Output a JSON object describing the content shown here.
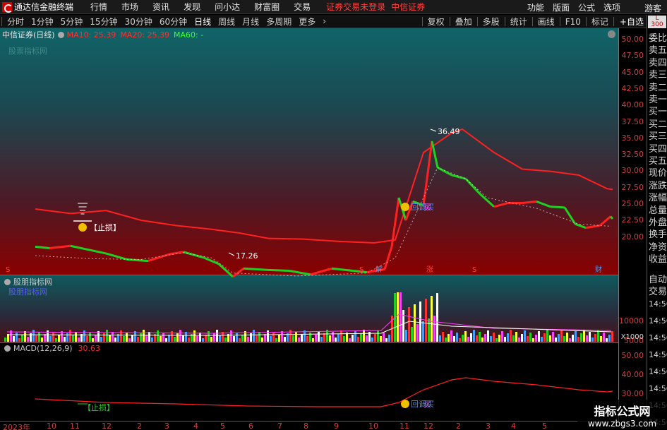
{
  "app": {
    "title": "通达信金融终端"
  },
  "menu": [
    "行情",
    "市场",
    "资讯",
    "发现",
    "问小达",
    "财富圈",
    "交易"
  ],
  "notice": "证券交易未登录",
  "broker": "中信证券",
  "right_menu": [
    "功能",
    "版面",
    "公式",
    "选项"
  ],
  "guest": "游客",
  "periods": [
    "分时",
    "1分钟",
    "5分钟",
    "15分钟",
    "30分钟",
    "60分钟",
    "日线",
    "周线",
    "月线",
    "多周期",
    "更多"
  ],
  "active_period": "日线",
  "toolbar_right": [
    "复权",
    "叠加",
    "多股",
    "统计",
    "画线",
    "F10",
    "标记",
    "+自选"
  ],
  "chart_title": {
    "symbol": "中信证券(日线)",
    "ma10": "MA10: 25.39",
    "ma20": "MA20: 25.39",
    "ma60": "MA60: -"
  },
  "main_watermark": "股票指标网",
  "volume_title": "股朋指标网",
  "volume_sub": "股朋指标网",
  "volume_unit": "X1000",
  "macd_title": "MACD(12,26,9)",
  "macd_value": "30.63",
  "main_y_ticks": [
    "50.00",
    "47.50",
    "45.00",
    "42.50",
    "40.00",
    "37.50",
    "35.00",
    "32.50",
    "30.00",
    "27.50",
    "25.00",
    "22.50",
    "20.00"
  ],
  "vol_y_ticks": [
    "10000",
    "5000"
  ],
  "macd_y_ticks": [
    "50.00",
    "40.00",
    "30.00"
  ],
  "x_ticks": [
    "2023年",
    "10",
    "11",
    "12",
    "2",
    "3",
    "4",
    "5",
    "6",
    "7",
    "8",
    "9",
    "10",
    "11",
    "12",
    "2",
    "3",
    "4",
    "5"
  ],
  "annotations": {
    "high": "36.49",
    "low": "17.26",
    "stop_loss": "【止损】",
    "buy": "买",
    "back_buy": "回调买",
    "markers": [
      "S",
      "S",
      "解",
      "涨",
      "S",
      "财"
    ]
  },
  "quote_panel": {
    "badge_top": "L",
    "badge_num": "300",
    "items": [
      "委比",
      "卖五",
      "卖四",
      "卖三",
      "卖二",
      "卖一",
      "买一",
      "买二",
      "买三",
      "买四",
      "买五",
      "现价",
      "涨跌",
      "涨幅",
      "总量",
      "外盘",
      "换手",
      "净资",
      "收益"
    ],
    "auto": "自动",
    "trade": "交易",
    "times": [
      "14:56",
      "14:56",
      "14:56",
      "14:56",
      "14:56",
      "14:56",
      "14:56",
      "14:56"
    ]
  },
  "ad": {
    "title": "指标公式网",
    "url": "www.zbgs3.com"
  },
  "colors": {
    "up": "#ff2020",
    "down": "#20d020",
    "ma_band": "#ff2020",
    "axis_text": "#d04040"
  }
}
